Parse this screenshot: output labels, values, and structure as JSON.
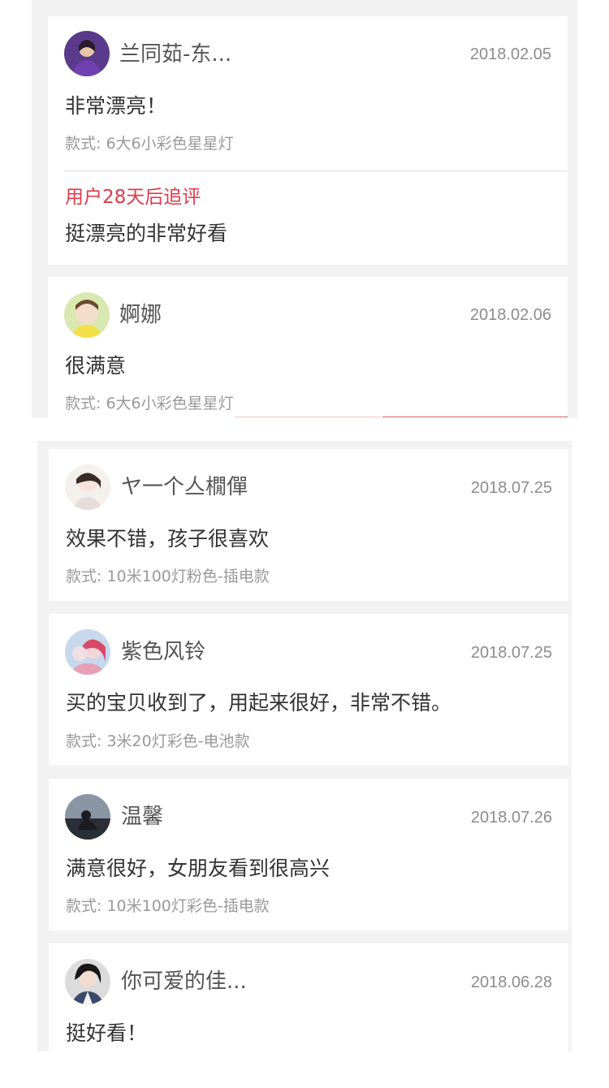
{
  "reviews_top": [
    {
      "username": "兰同茹-东...",
      "date": "2018.02.05",
      "text": "非常漂亮！",
      "style": "款式: 6大6小彩色星星灯",
      "followup_label": "用户28天后追评",
      "followup_text": "挺漂亮的非常好看"
    },
    {
      "username": "婀娜",
      "date": "2018.02.06",
      "text": "很满意",
      "style": "款式: 6大6小彩色星星灯"
    }
  ],
  "reviews_bottom": [
    {
      "username": "ヤ一个亼橌僤",
      "date": "2018.07.25",
      "text": "效果不错，孩子很喜欢",
      "style": "款式: 10米100灯粉色-插电款"
    },
    {
      "username": "紫色风铃",
      "date": "2018.07.25",
      "text": "买的宝贝收到了，用起来很好，非常不错。",
      "style": "款式: 3米20灯彩色-电池款"
    },
    {
      "username": "温馨",
      "date": "2018.07.26",
      "text": "满意很好，女朋友看到很高兴",
      "style": "款式: 10米100灯彩色-插电款"
    },
    {
      "username": "你可爱的佳...",
      "date": "2018.06.28",
      "text": "挺好看！"
    }
  ]
}
